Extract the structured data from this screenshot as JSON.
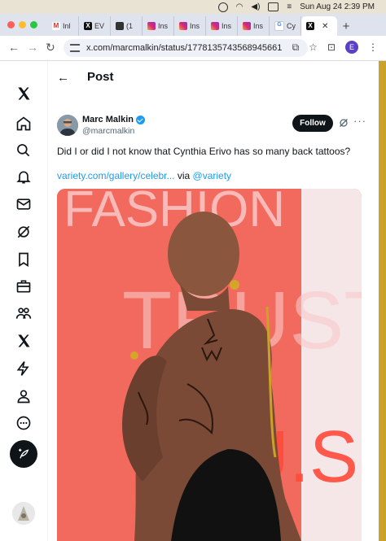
{
  "menubar": {
    "datetime": "Sun Aug 24  2:39 PM"
  },
  "browser": {
    "tabs": [
      {
        "icon": "gmail-icon",
        "label": "Inl"
      },
      {
        "icon": "x-logo-icon",
        "label": "EV"
      },
      {
        "icon": "ev-icon",
        "label": "(1"
      },
      {
        "icon": "instagram-icon",
        "label": "Ins"
      },
      {
        "icon": "instagram-icon",
        "label": "Ins"
      },
      {
        "icon": "instagram-icon",
        "label": "Ins"
      },
      {
        "icon": "instagram-icon",
        "label": "Ins"
      },
      {
        "icon": "google-icon",
        "label": "Cy"
      },
      {
        "icon": "x-logo-icon",
        "label": "",
        "active": true
      }
    ],
    "url": "x.com/marcmalkin/status/1778135743568945661",
    "profile_initial": "E"
  },
  "header": {
    "title": "Post"
  },
  "tweet": {
    "author_name": "Marc Malkin",
    "author_handle": "@marcmalkin",
    "follow_label": "Follow",
    "more_label": "···",
    "text": "Did I or did I not know that Cynthia Erivo has so many back tattoos?",
    "link_text": "variety.com/gallery/celebr...",
    "via_text": "via",
    "via_handle": "@variety"
  },
  "media": {
    "backdrop_text": "FASHION TRUST U.S."
  },
  "colors": {
    "accent": "#1d9bf0",
    "text": "#0f1419",
    "muted": "#536471",
    "backdrop": "#f36e63",
    "letters": "#f9c9c9"
  }
}
